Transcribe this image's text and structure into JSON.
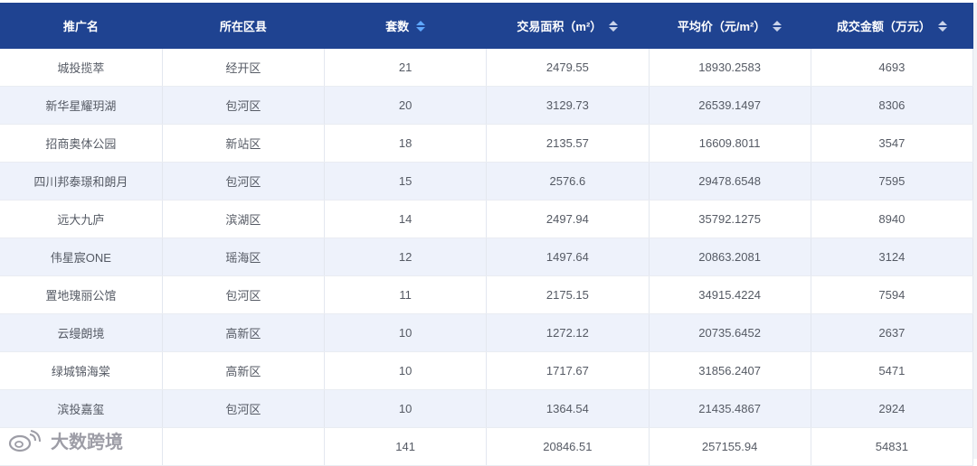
{
  "table": {
    "columns": [
      {
        "label": "推广名",
        "sortable": false
      },
      {
        "label": "所在区县",
        "sortable": false
      },
      {
        "label": "套数",
        "sortable": true,
        "sort_active": true
      },
      {
        "label": "交易面积（m²）",
        "sortable": true,
        "sort_active": false
      },
      {
        "label": "平均价（元/m²）",
        "sortable": true,
        "sort_active": false
      },
      {
        "label": "成交金额（万元）",
        "sortable": true,
        "sort_active": false
      }
    ],
    "rows": [
      [
        "城投揽萃",
        "经开区",
        "21",
        "2479.55",
        "18930.2583",
        "4693"
      ],
      [
        "新华星耀玥湖",
        "包河区",
        "20",
        "3129.73",
        "26539.1497",
        "8306"
      ],
      [
        "招商奥体公园",
        "新站区",
        "18",
        "2135.57",
        "16609.8011",
        "3547"
      ],
      [
        "四川邦泰璟和朗月",
        "包河区",
        "15",
        "2576.6",
        "29478.6548",
        "7595"
      ],
      [
        "远大九庐",
        "滨湖区",
        "14",
        "2497.94",
        "35792.1275",
        "8940"
      ],
      [
        "伟星宸ONE",
        "瑶海区",
        "12",
        "1497.64",
        "20863.2081",
        "3124"
      ],
      [
        "置地瑰丽公馆",
        "包河区",
        "11",
        "2175.15",
        "34915.4224",
        "7594"
      ],
      [
        "云缦朗境",
        "高新区",
        "10",
        "1272.12",
        "20735.6452",
        "2637"
      ],
      [
        "绿城锦海棠",
        "高新区",
        "10",
        "1717.67",
        "31856.2407",
        "5471"
      ],
      [
        "滨投嘉玺",
        "包河区",
        "10",
        "1364.54",
        "21435.4867",
        "2924"
      ]
    ],
    "total_row": [
      "",
      "",
      "141",
      "20846.51",
      "257155.94",
      "54831"
    ]
  },
  "watermark": {
    "text": "大数跨境",
    "icon": "sina-weibo-logo-icon"
  },
  "colors": {
    "header_bg": "#1f4391",
    "stripe_bg": "#eef2fb",
    "sort_active": "#5fa8ff"
  }
}
